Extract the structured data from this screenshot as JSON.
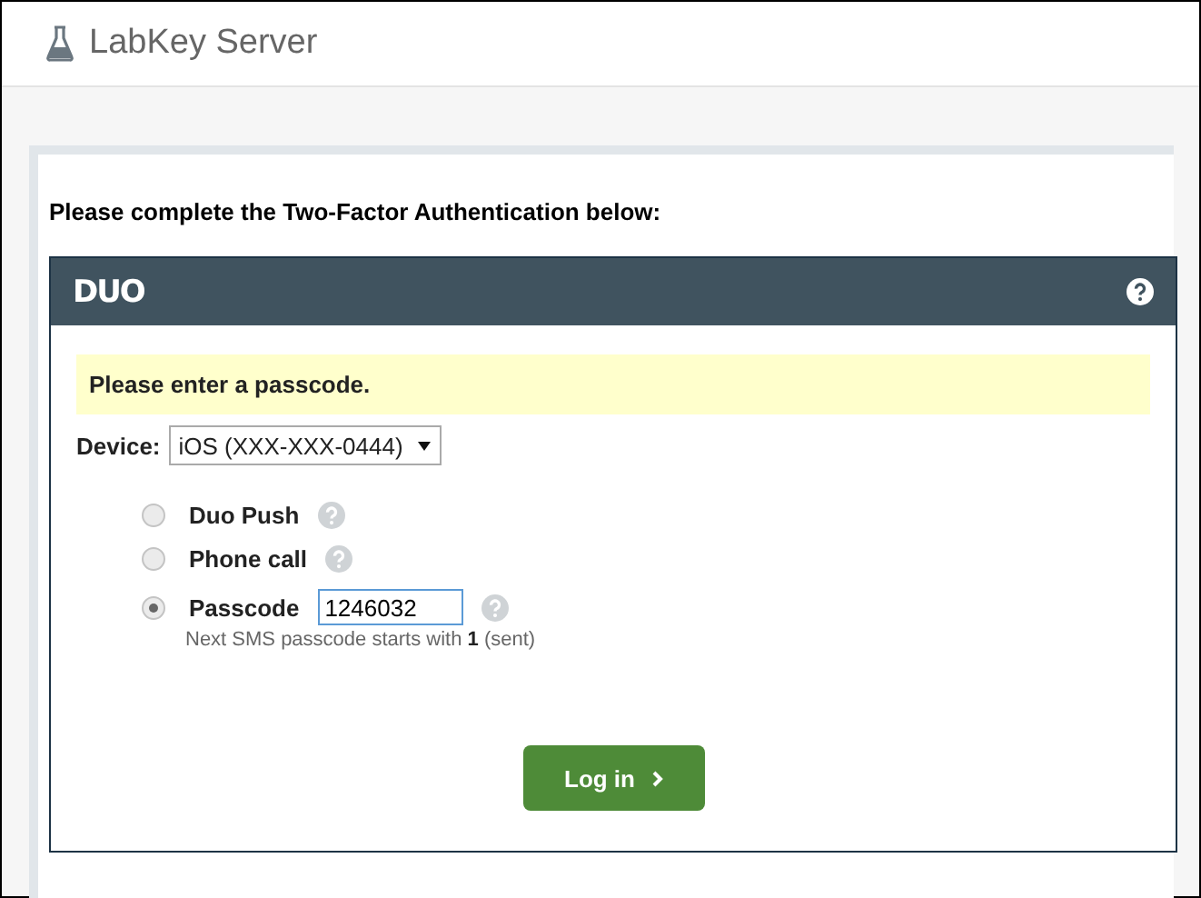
{
  "header": {
    "title": "LabKey Server"
  },
  "heading": "Please complete the Two-Factor Authentication below:",
  "duo": {
    "logo": "DUO",
    "message": "Please enter a passcode.",
    "device_label": "Device:",
    "device": "iOS (XXX-XXX-0444)",
    "methods": [
      {
        "kind": "push",
        "label": "Duo Push",
        "selected": false
      },
      {
        "kind": "phone",
        "label": "Phone call",
        "selected": false
      },
      {
        "kind": "passcode",
        "label": "Passcode",
        "selected": true,
        "value": "1246032",
        "hint": "Next SMS passcode starts with **1** (sent)"
      }
    ],
    "button": "Log in"
  }
}
